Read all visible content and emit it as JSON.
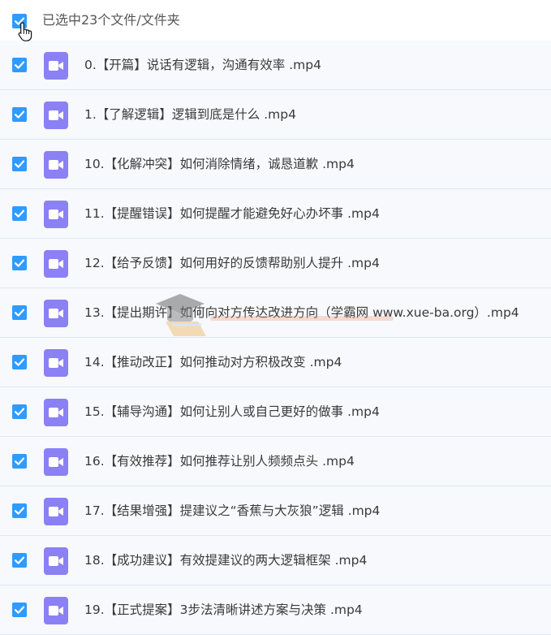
{
  "header": {
    "selection_text": "已选中23个文件/文件夹"
  },
  "icons": {
    "checkbox": "checkbox-checked-icon",
    "file": "video-file-icon",
    "cursor": "hand-pointer-icon"
  },
  "colors": {
    "checkbox": "#2f9bff",
    "video_icon": "#8c80f5",
    "row_background": "#f7f9fc",
    "row_divider": "#dde8f5"
  },
  "files": [
    {
      "name": "0.【开篇】说话有逻辑，沟通有效率 .mp4"
    },
    {
      "name": "1.【了解逻辑】逻辑到底是什么 .mp4"
    },
    {
      "name": "10.【化解冲突】如何消除情绪，诚恳道歉 .mp4"
    },
    {
      "name": "11.【提醒错误】如何提醒才能避免好心办坏事 .mp4"
    },
    {
      "name": "12.【给予反馈】如何用好的反馈帮助别人提升 .mp4"
    },
    {
      "name": "13.【提出期许】如何向对方传达改进方向（学霸网 www.xue-ba.org）.mp4"
    },
    {
      "name": "14.【推动改正】如何推动对方积极改变 .mp4"
    },
    {
      "name": "15.【辅导沟通】如何让别人或自己更好的做事 .mp4"
    },
    {
      "name": "16.【有效推荐】如何推荐让别人频频点头 .mp4"
    },
    {
      "name": "17.【结果增强】提建议之“香蕉与大灰狼”逻辑 .mp4"
    },
    {
      "name": "18.【成功建议】有效提建议的两大逻辑框架 .mp4"
    },
    {
      "name": "19.【正式提案】3步法清晰讲述方案与决策 .mp4"
    }
  ]
}
